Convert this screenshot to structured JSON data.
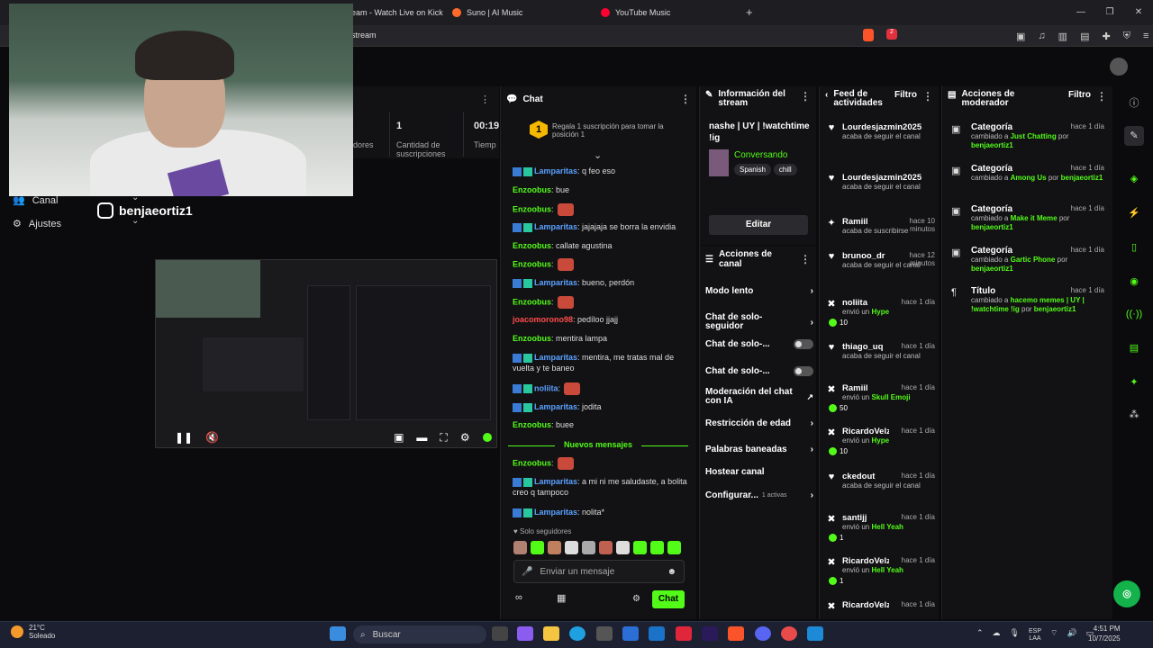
{
  "browser": {
    "tabs": [
      {
        "label": "eam - Watch Live on Kick"
      },
      {
        "label": "Suno | AI Music"
      },
      {
        "label": "YouTube Music"
      }
    ],
    "new_tab": "+",
    "address": "stream",
    "window_controls": [
      "—",
      "❐",
      "✕"
    ],
    "ext_badge": "2"
  },
  "left_menu": {
    "items": [
      {
        "label": "Canal",
        "icon": "users-icon"
      },
      {
        "label": "Ajustes",
        "icon": "gear-icon"
      }
    ],
    "instagram_handle": "benjaeortiz1"
  },
  "stats": {
    "value1": "1",
    "label1": "Cantidad de suscripciones",
    "value2": "00:19",
    "label2": "Tiemp",
    "partial_label": "dores"
  },
  "chat": {
    "title": "Chat",
    "pinned": "Regala 1 suscripción para tomar la posición 1",
    "pinned_rank": "1",
    "messages": [
      {
        "user": "Lamparitas",
        "color": "blue",
        "badges": true,
        "text": ": q feo eso"
      },
      {
        "user": "Enzoobus",
        "color": "green",
        "badges": false,
        "text": ": bue"
      },
      {
        "user": "Enzoobus",
        "color": "green",
        "badges": false,
        "text": ":",
        "emote": true
      },
      {
        "user": "Lamparitas",
        "color": "blue",
        "badges": true,
        "text": ": jajajaja se borra la envidia"
      },
      {
        "user": "Enzoobus",
        "color": "green",
        "badges": false,
        "text": ": callate agustina"
      },
      {
        "user": "Enzoobus",
        "color": "green",
        "badges": false,
        "text": ":",
        "emote": true
      },
      {
        "user": "Lamparitas",
        "color": "blue",
        "badges": true,
        "text": ": bueno, perdón"
      },
      {
        "user": "Enzoobus",
        "color": "green",
        "badges": false,
        "text": ":",
        "emote": true
      },
      {
        "user": "joacomorono98",
        "color": "red",
        "badges": false,
        "text": ": pedíloo jjajj"
      },
      {
        "user": "Enzoobus",
        "color": "green",
        "badges": false,
        "text": ": mentira lampa"
      },
      {
        "user": "Lamparitas",
        "color": "blue",
        "badges": true,
        "text": ": mentira, me tratas mal de vuelta y te baneo"
      },
      {
        "user": "noliita",
        "color": "blue",
        "badges": true,
        "text": ":",
        "emote": true
      },
      {
        "user": "Lamparitas",
        "color": "blue",
        "badges": true,
        "text": ": jodita"
      },
      {
        "user": "Enzoobus",
        "color": "green",
        "badges": false,
        "text": ": buee"
      }
    ],
    "new_messages_label": "Nuevos mensajes",
    "new_messages": [
      {
        "user": "Enzoobus",
        "color": "green",
        "badges": false,
        "text": ":",
        "emote": true
      },
      {
        "user": "Lamparitas",
        "color": "blue",
        "badges": true,
        "text": ": a mi ni me saludaste, a bolita creo q tampoco"
      },
      {
        "user": "Lamparitas",
        "color": "blue",
        "badges": true,
        "text": ": nolita*"
      }
    ],
    "followers_only": "Solo seguidores",
    "input_placeholder": "Enviar un mensaje",
    "send_label": "Chat"
  },
  "stream_info": {
    "title": "Información del stream",
    "stream_title": "nashe | UY | !watchtime !ig",
    "category": "Conversando",
    "tags": [
      "Spanish",
      "chill"
    ],
    "edit_label": "Editar"
  },
  "channel_actions": {
    "title": "Acciones de canal",
    "items": [
      {
        "label": "Modo lento",
        "control": "chevron"
      },
      {
        "label": "Chat de solo-seguidor",
        "control": "chevron"
      },
      {
        "label": "Chat de solo-...",
        "control": "toggle"
      },
      {
        "label": "Chat de solo-...",
        "control": "toggle"
      },
      {
        "label": "Moderación del chat con IA",
        "control": "external"
      },
      {
        "label": "Restricción de edad",
        "control": "chevron"
      },
      {
        "label": "Palabras baneadas",
        "control": "chevron"
      },
      {
        "label": "Hostear canal",
        "control": "none"
      },
      {
        "label": "Configurar...",
        "control": "chevron",
        "extra": "1 activas"
      }
    ]
  },
  "feed": {
    "title": "Feed de actividades",
    "filter_label": "Filtro",
    "items": [
      {
        "icon": "heart-icon",
        "user": "Lourdesjazmin2025",
        "time": "",
        "desc": "acaba de seguir el canal"
      },
      {
        "icon": "heart-icon",
        "user": "Lourdesjazmin2025",
        "time": "",
        "desc": "acaba de seguir el canal"
      },
      {
        "icon": "star-icon",
        "user": "Ramiil",
        "time": "hace 10 minutos",
        "desc": "acaba de suscribirse"
      },
      {
        "icon": "heart-icon",
        "user": "brunoo_dr",
        "time": "hace 12 minutos",
        "desc": "acaba de seguir el canal"
      },
      {
        "icon": "kick-icon",
        "user": "noliita",
        "time": "hace 1 día",
        "desc": "envió un ",
        "highlight": "Hype",
        "amount": "10"
      },
      {
        "icon": "heart-icon",
        "user": "thiago_uq",
        "time": "hace 1 día",
        "desc": "acaba de seguir el canal"
      },
      {
        "icon": "kick-icon",
        "user": "Ramiil",
        "time": "hace 1 día",
        "desc": "envió un ",
        "highlight": "Skull Emoji",
        "amount": "50"
      },
      {
        "icon": "kick-icon",
        "user": "RicardoVelz",
        "time": "hace 1 día",
        "desc": "envió un ",
        "highlight": "Hype",
        "amount": "10"
      },
      {
        "icon": "heart-icon",
        "user": "ckedout",
        "time": "hace 1 día",
        "desc": "acaba de seguir el canal"
      },
      {
        "icon": "kick-icon",
        "user": "santijj",
        "time": "hace 1 día",
        "desc": "envió un ",
        "highlight": "Hell Yeah",
        "amount": "1"
      },
      {
        "icon": "kick-icon",
        "user": "RicardoVelz",
        "time": "hace 1 día",
        "desc": "envió un ",
        "highlight": "Hell Yeah",
        "amount": "1"
      },
      {
        "icon": "kick-icon",
        "user": "RicardoVelz",
        "time": "hace 1 día",
        "desc": ""
      }
    ]
  },
  "mod_actions": {
    "title": "Acciones de moderador",
    "filter_label": "Filtro",
    "items": [
      {
        "title": "Categoría",
        "time": "hace 1 día",
        "pre": "cambiado a ",
        "value": "Just Chatting",
        "by": "benjaeortiz1"
      },
      {
        "title": "Categoría",
        "time": "hace 1 día",
        "pre": "cambiado a ",
        "value": "Among Us",
        "by": "benjaeortiz1"
      },
      {
        "title": "Categoría",
        "time": "hace 1 día",
        "pre": "cambiado a ",
        "value": "Make it Meme",
        "by": "benjaeortiz1"
      },
      {
        "title": "Categoría",
        "time": "hace 1 día",
        "pre": "cambiado a ",
        "value": "Gartic Phone",
        "by": "benjaeortiz1"
      },
      {
        "title": "Título",
        "time": "hace 1 día",
        "pre": "cambiado a ",
        "value": "hacemo memes | UY | !watchtime !ig",
        "by": "benjaeortiz1"
      }
    ]
  },
  "taskbar": {
    "temp": "21°C",
    "weather": "Soleado",
    "search": "Buscar",
    "lang1": "ESP",
    "lang2": "LAA",
    "time": "4:51 PM",
    "date": "10/7/2025"
  },
  "colors": {
    "kick_green": "#53fc18",
    "bg": "#0b0b0d",
    "panel": "#121214"
  }
}
